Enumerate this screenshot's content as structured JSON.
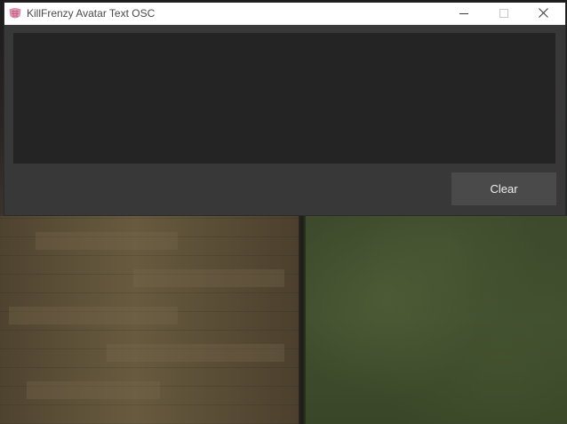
{
  "window": {
    "title": "KillFrenzy Avatar Text OSC",
    "icon": "app-logo-icon",
    "caption_buttons": [
      "minimize-icon",
      "maximize-icon",
      "close-icon"
    ]
  },
  "editor": {
    "value": "",
    "placeholder": ""
  },
  "actions": {
    "clear_label": "Clear"
  },
  "colors": {
    "titlebar_bg": "#ffffff",
    "window_bg": "#383838",
    "textarea_bg": "#242424",
    "button_bg": "#4a4a4a",
    "button_text": "#f0f0f0",
    "app_icon": "#e89ab8"
  }
}
